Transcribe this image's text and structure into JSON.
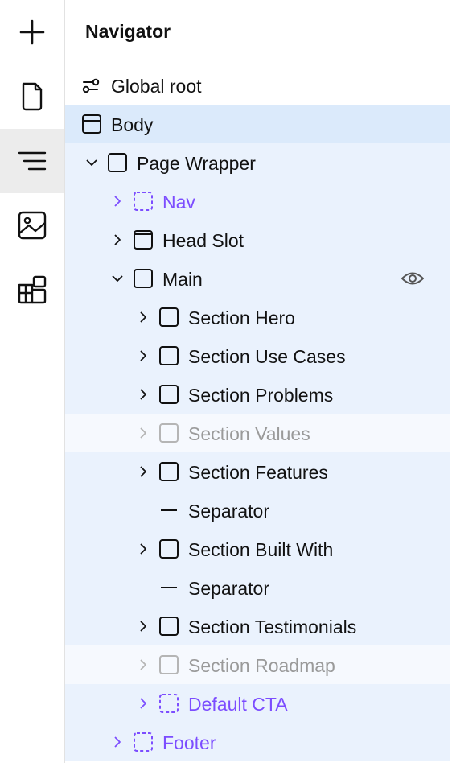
{
  "rail": {
    "items": [
      {
        "icon": "plus-icon"
      },
      {
        "icon": "page-icon"
      },
      {
        "icon": "navigator-icon"
      },
      {
        "icon": "image-icon"
      },
      {
        "icon": "components-icon"
      }
    ]
  },
  "navigator": {
    "title": "Navigator",
    "items": [
      {
        "label": "Global root",
        "icon": "global-root-icon"
      },
      {
        "label": "Body",
        "icon": "body-icon"
      },
      {
        "label": "Page Wrapper",
        "icon": "box-icon"
      },
      {
        "label": "Nav",
        "icon": "component-box-icon"
      },
      {
        "label": "Head Slot",
        "icon": "slot-icon"
      },
      {
        "label": "Main",
        "icon": "box-icon"
      },
      {
        "label": "Section Hero",
        "icon": "box-icon"
      },
      {
        "label": "Section Use Cases",
        "icon": "box-icon"
      },
      {
        "label": "Section Problems",
        "icon": "box-icon"
      },
      {
        "label": "Section Values",
        "icon": "box-icon"
      },
      {
        "label": "Section Features",
        "icon": "box-icon"
      },
      {
        "label": "Separator",
        "icon": "separator-icon"
      },
      {
        "label": "Section Built With",
        "icon": "box-icon"
      },
      {
        "label": "Separator",
        "icon": "separator-icon"
      },
      {
        "label": "Section Testimonials",
        "icon": "box-icon"
      },
      {
        "label": "Section Roadmap",
        "icon": "box-icon"
      },
      {
        "label": "Default CTA",
        "icon": "component-box-icon"
      },
      {
        "label": "Footer",
        "icon": "component-box-icon"
      }
    ]
  },
  "colors": {
    "selected_bg": "#dbeafb",
    "tree_bg": "#eaf2fd",
    "component_text": "#7c4dff",
    "hidden_text": "#9a9a9a"
  }
}
